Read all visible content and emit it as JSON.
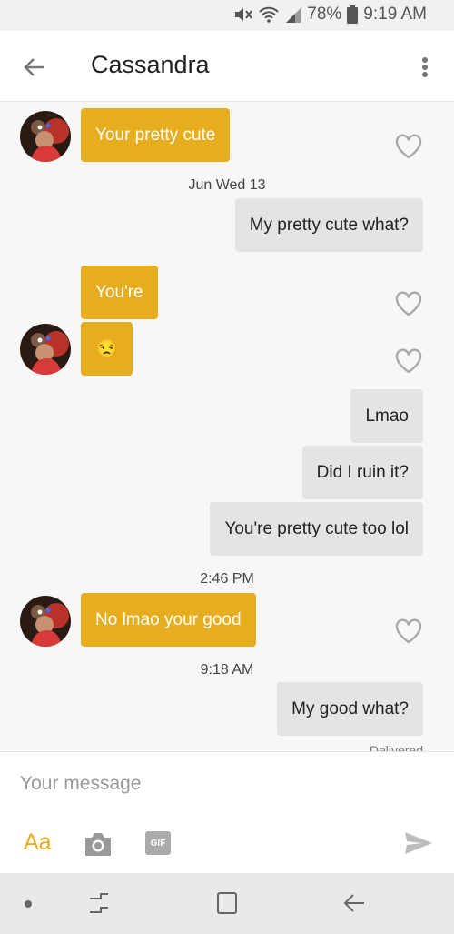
{
  "status_bar": {
    "battery": "78%",
    "time": "9:19 AM",
    "icons": [
      "mute-icon",
      "wifi-icon",
      "signal-icon",
      "battery-icon"
    ]
  },
  "header": {
    "title": "Cassandra",
    "back_icon": "arrow-back-icon",
    "menu_icon": "more-vert-icon"
  },
  "messages": [
    {
      "direction": "in",
      "text": "Your pretty cute"
    },
    {
      "type": "timestamp",
      "text": "Jun Wed 13"
    },
    {
      "direction": "out",
      "text": "My pretty cute what?"
    },
    {
      "direction": "in",
      "text": "You're"
    },
    {
      "direction": "in",
      "text": "😒"
    },
    {
      "direction": "out",
      "text": "Lmao"
    },
    {
      "direction": "out",
      "text": "Did I ruin it?"
    },
    {
      "direction": "out",
      "text": "You're pretty cute too lol"
    },
    {
      "type": "timestamp",
      "text": "2:46 PM"
    },
    {
      "direction": "in",
      "text": "No lmao your good"
    },
    {
      "type": "timestamp",
      "text": "9:18 AM"
    },
    {
      "direction": "out",
      "text": "My good what?"
    },
    {
      "type": "status",
      "text": "Delivered"
    }
  ],
  "composer": {
    "placeholder": "Your message",
    "value": "",
    "text_format_label": "Aa",
    "gif_label": "GIF",
    "camera_icon": "camera-icon",
    "send_icon": "send-icon"
  },
  "nav_bar": {
    "icons": [
      "dot-icon",
      "recents-icon",
      "home-icon",
      "back-icon"
    ]
  },
  "colors": {
    "incoming_bubble": "#e6ad1f",
    "outgoing_bubble": "#e4e4e4",
    "accent": "#e6ad1f"
  }
}
